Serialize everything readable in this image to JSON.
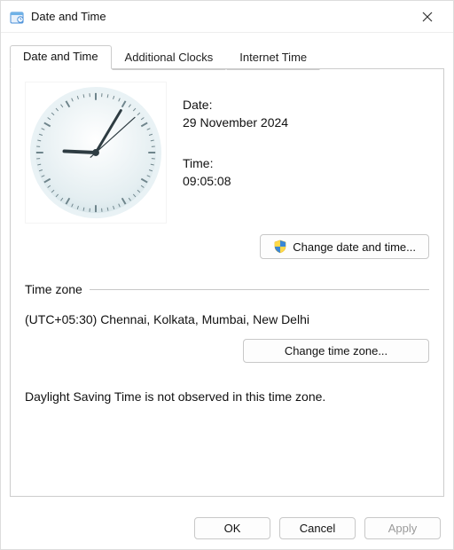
{
  "window": {
    "title": "Date and Time"
  },
  "tabs": {
    "items": [
      {
        "label": "Date and Time"
      },
      {
        "label": "Additional Clocks"
      },
      {
        "label": "Internet Time"
      }
    ]
  },
  "datetime": {
    "date_label": "Date:",
    "date_value": "29 November 2024",
    "time_label": "Time:",
    "time_value": "09:05:08"
  },
  "buttons": {
    "change_date_time": "Change date and time...",
    "change_time_zone": "Change time zone...",
    "ok": "OK",
    "cancel": "Cancel",
    "apply": "Apply"
  },
  "timezone": {
    "section_label": "Time zone",
    "value": "(UTC+05:30) Chennai, Kolkata, Mumbai, New Delhi"
  },
  "dst": {
    "note": "Daylight Saving Time is not observed in this time zone."
  },
  "clock": {
    "hour": 9,
    "minute": 5,
    "second": 8
  }
}
